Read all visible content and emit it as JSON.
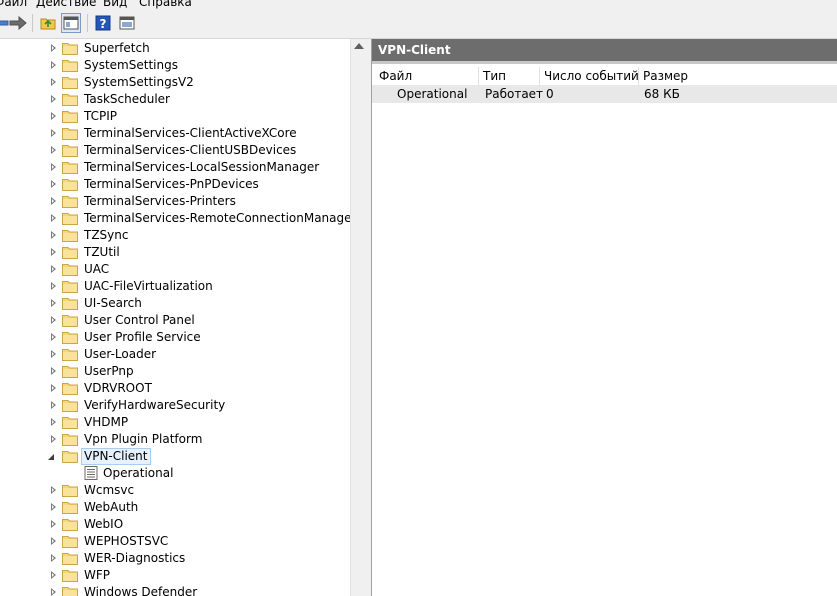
{
  "menu": {
    "items": [
      "Файл",
      "Действие",
      "Вид",
      "Справка"
    ]
  },
  "toolbar": {
    "buttons": [
      "back-arrow-icon",
      "forward-arrow-icon",
      "up-folder-icon",
      "show-hide-tree-icon",
      "help-icon",
      "properties-icon"
    ]
  },
  "tree": {
    "items": [
      {
        "label": "Superfetch"
      },
      {
        "label": "SystemSettings"
      },
      {
        "label": "SystemSettingsV2"
      },
      {
        "label": "TaskScheduler"
      },
      {
        "label": "TCPIP"
      },
      {
        "label": "TerminalServices-ClientActiveXCore"
      },
      {
        "label": "TerminalServices-ClientUSBDevices"
      },
      {
        "label": "TerminalServices-LocalSessionManager"
      },
      {
        "label": "TerminalServices-PnPDevices"
      },
      {
        "label": "TerminalServices-Printers"
      },
      {
        "label": "TerminalServices-RemoteConnectionManager"
      },
      {
        "label": "TZSync"
      },
      {
        "label": "TZUtil"
      },
      {
        "label": "UAC"
      },
      {
        "label": "UAC-FileVirtualization"
      },
      {
        "label": "UI-Search"
      },
      {
        "label": "User Control Panel"
      },
      {
        "label": "User Profile Service"
      },
      {
        "label": "User-Loader"
      },
      {
        "label": "UserPnp"
      },
      {
        "label": "VDRVROOT"
      },
      {
        "label": "VerifyHardwareSecurity"
      },
      {
        "label": "VHDMP"
      },
      {
        "label": "Vpn Plugin Platform"
      },
      {
        "label": "VPN-Client",
        "expanded": true,
        "selected": true
      },
      {
        "label": "Operational",
        "child": true
      },
      {
        "label": "Wcmsvc"
      },
      {
        "label": "WebAuth"
      },
      {
        "label": "WebIO"
      },
      {
        "label": "WEPHOSTSVC"
      },
      {
        "label": "WER-Diagnostics"
      },
      {
        "label": "WFP"
      },
      {
        "label": "Windows Defender"
      }
    ]
  },
  "details": {
    "title": "VPN-Client",
    "columns": [
      "Файл",
      "Тип",
      "Число событий",
      "Размер"
    ],
    "rows": [
      [
        "Operational",
        "Работает",
        "0",
        "68 КБ"
      ]
    ]
  },
  "colors": {
    "title_bar": "#6d6d6d",
    "selection_fill": "#e5f1fb",
    "selection_border": "#a8cdee",
    "folder": "#f5d77a"
  }
}
